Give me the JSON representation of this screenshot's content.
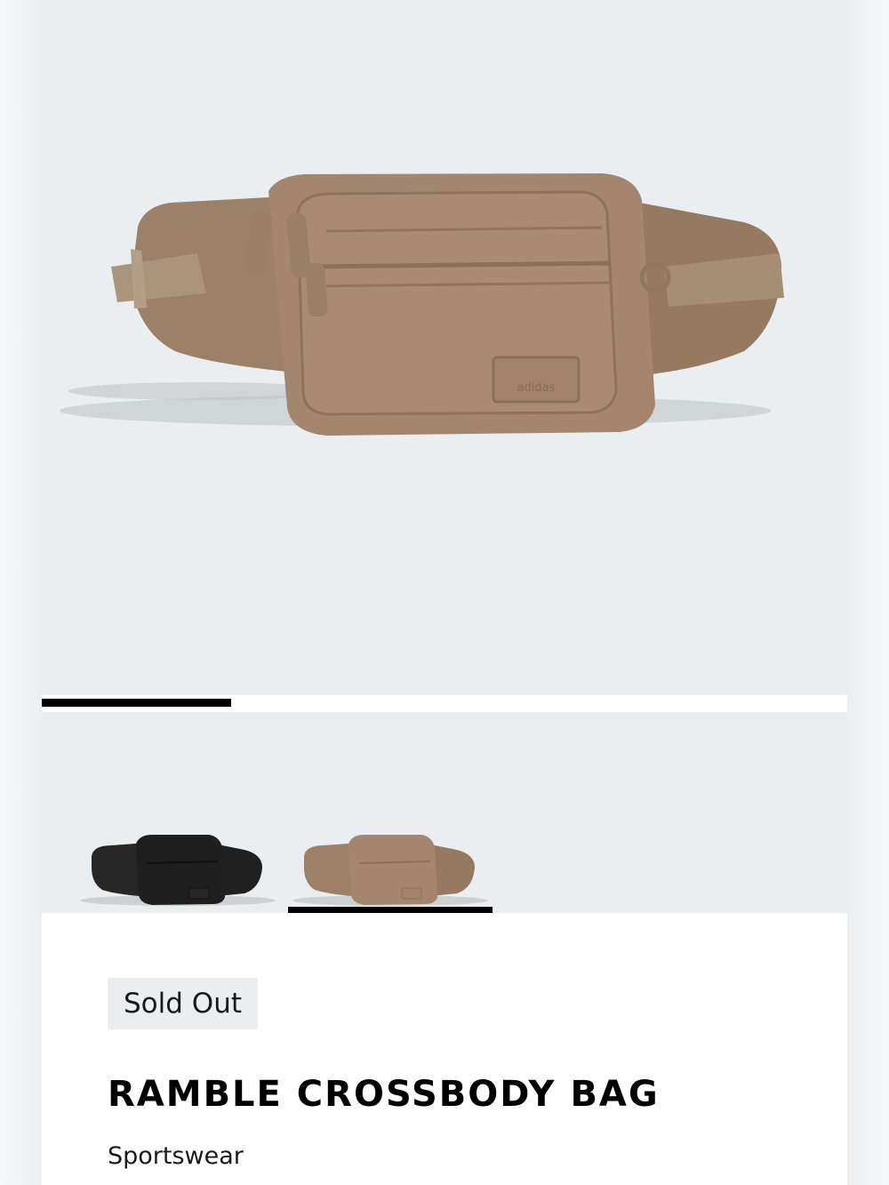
{
  "gallery": {
    "main_image_alt": "Ramble Crossbody Bag",
    "brand_logo_text": "adidas",
    "progress": 0.235,
    "thumbnails": [
      {
        "color": "black",
        "selected": false
      },
      {
        "color": "brown",
        "selected": true
      }
    ]
  },
  "product": {
    "availability_badge": "Sold Out",
    "name": "RAMBLE CROSSBODY BAG",
    "category": "Sportswear"
  },
  "colors": {
    "page_background": "#eaeef0",
    "bag_brown": "#a3866d",
    "bag_black": "#1f1f1f",
    "progress": "#000000"
  }
}
